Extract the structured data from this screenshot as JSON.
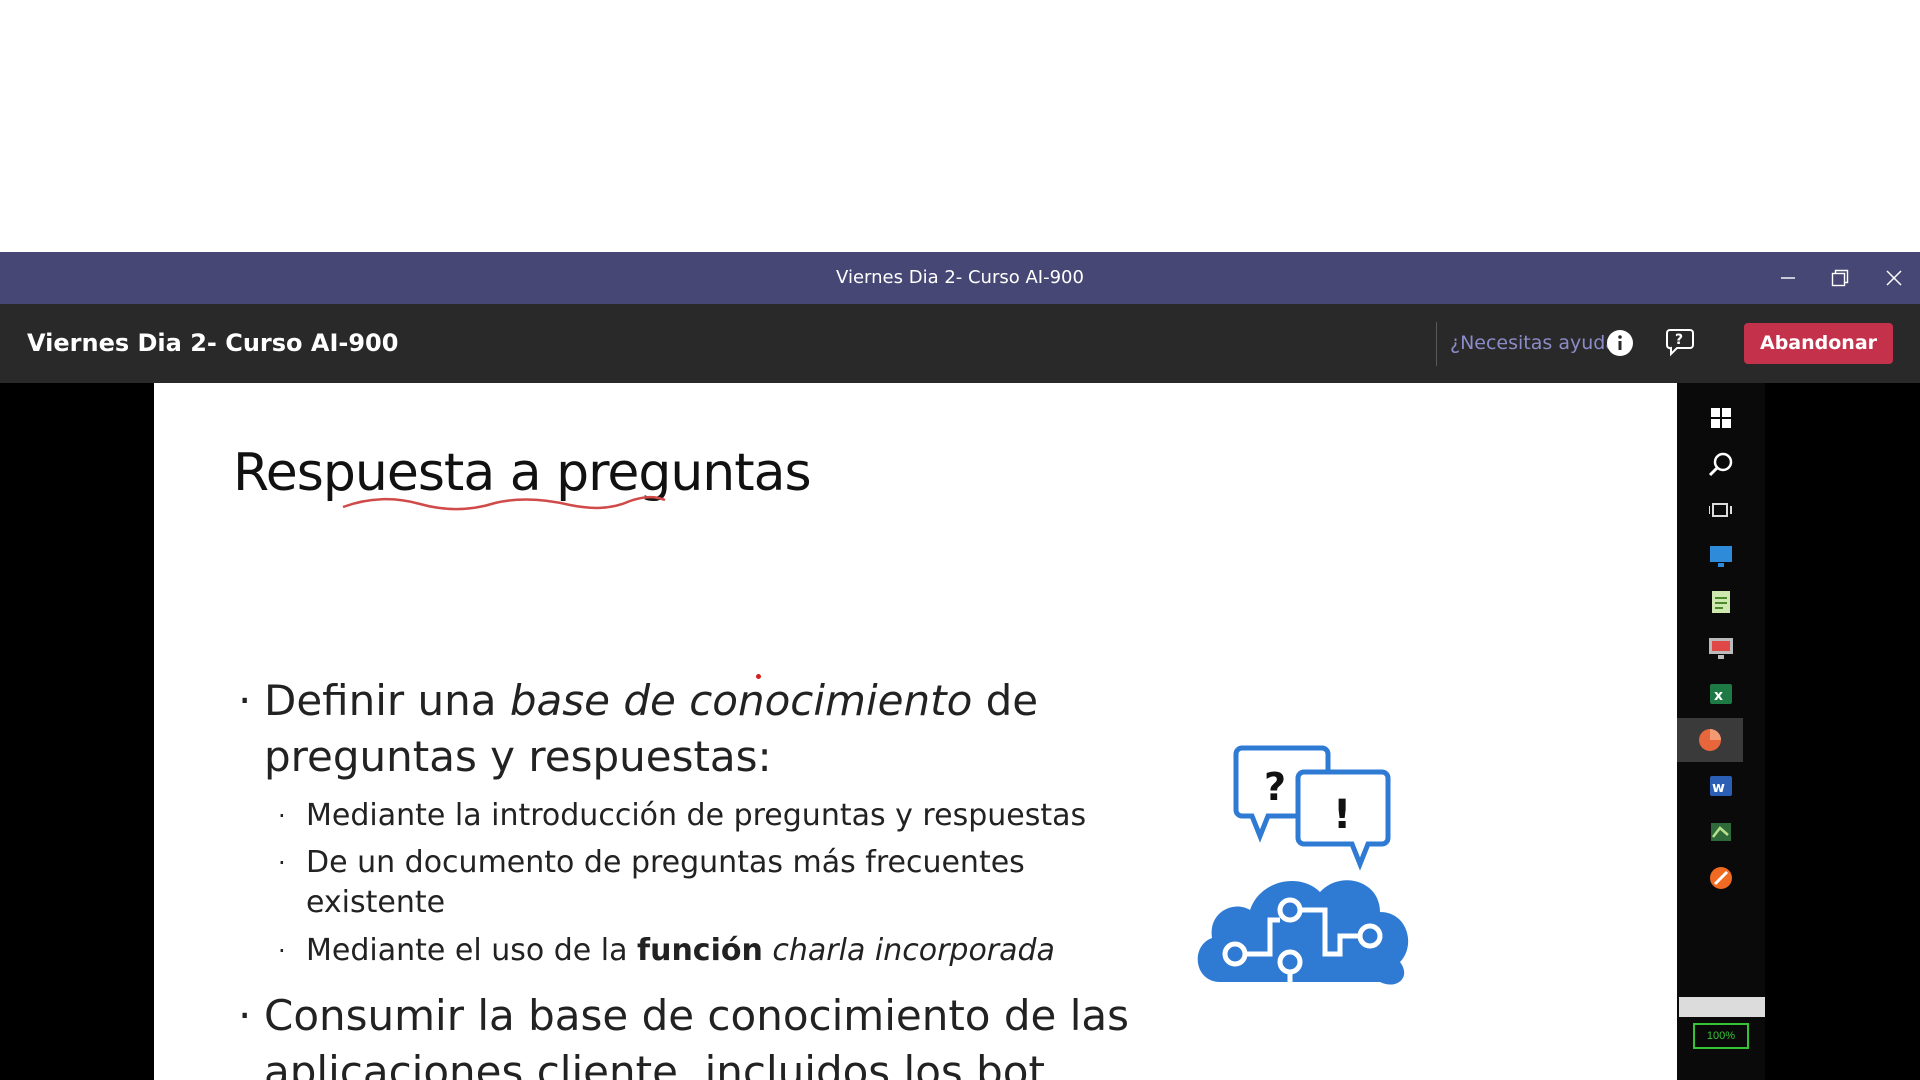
{
  "window": {
    "title": "Viernes Dia 2- Curso AI-900",
    "controls": [
      "minimize",
      "restore",
      "close"
    ]
  },
  "meeting": {
    "title": "Viernes Dia 2- Curso AI-900",
    "help_link": "¿Necesitas ayuda?",
    "leave_button": "Abandonar"
  },
  "slide": {
    "title": "Respuesta a preguntas",
    "bullet1": {
      "text_before": "Definir una ",
      "text_italic": "base de conocimiento",
      "text_after": " de preguntas y respuestas:",
      "subitems": [
        "Mediante la introducción de preguntas y respuestas",
        "De un documento de preguntas más frecuentes existente"
      ],
      "subitem3": {
        "before": "Mediante el uso de la ",
        "bold": "función",
        "italic": "charla incorporada"
      }
    },
    "bullet2": "Consumir la base de conocimiento de las aplicaciones cliente, incluidos los bot"
  },
  "taskbar": {
    "items": [
      "windows-icon",
      "search-icon",
      "task-view-icon",
      "monitor-icon",
      "notepad-icon",
      "remote-desktop-icon",
      "excel-icon",
      "powerpoint-icon",
      "word-icon",
      "app-icon",
      "firefox-icon"
    ],
    "battery": "100%"
  },
  "colors": {
    "titlebar": "#464775",
    "meetbar": "#292929",
    "leave": "#c4314b",
    "help": "#8b8cc7",
    "icon_blue": "#2f7bd4"
  }
}
